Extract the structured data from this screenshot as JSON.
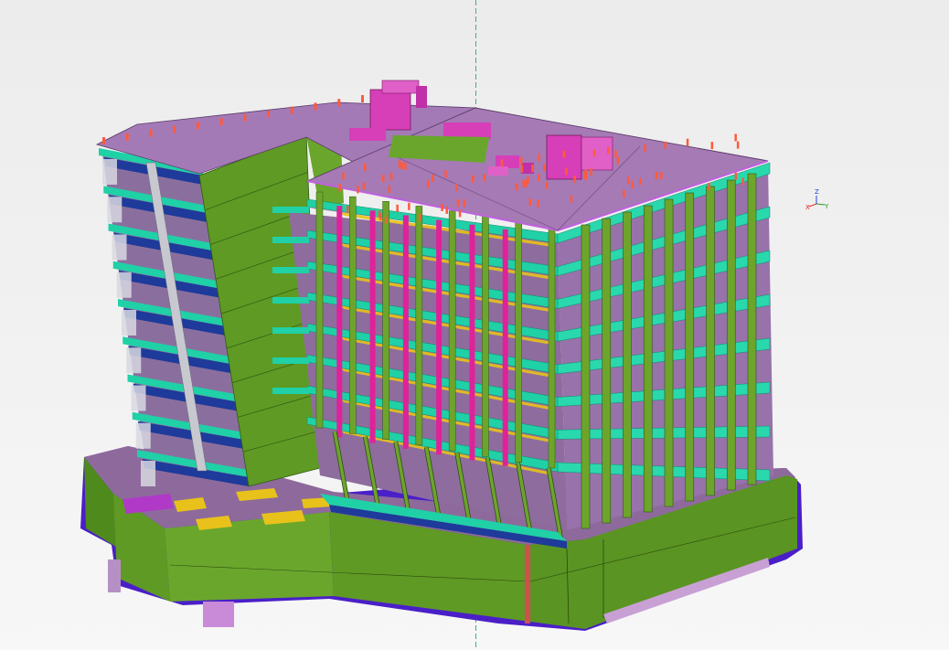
{
  "viewport": {
    "background": "#efefef",
    "work_plane_guide_color": "#3cb371"
  },
  "view_axes": {
    "x_label": "X",
    "y_label": "Y",
    "z_label": "Z",
    "x_color": "#e02020",
    "y_color": "#20a020",
    "z_color": "#2040e0"
  },
  "model": {
    "wall_color": "#5f9a24",
    "slab_color": "#9b6fa8",
    "slab_top_color": "#a67ab5",
    "column_color": "#6da42c",
    "interior_column_color": "#e0229a",
    "slab_edge_beam_color": "#20d0a6",
    "rebar_stub_color": "#ff5a3c",
    "rooftop_unit_color": "#d63fb8",
    "foundation_color": "#4a1fc8",
    "opening_color": "#e8c21a",
    "brace_color": "#c8c8d0",
    "right_block_floors": 8,
    "left_block_floors": 9
  }
}
